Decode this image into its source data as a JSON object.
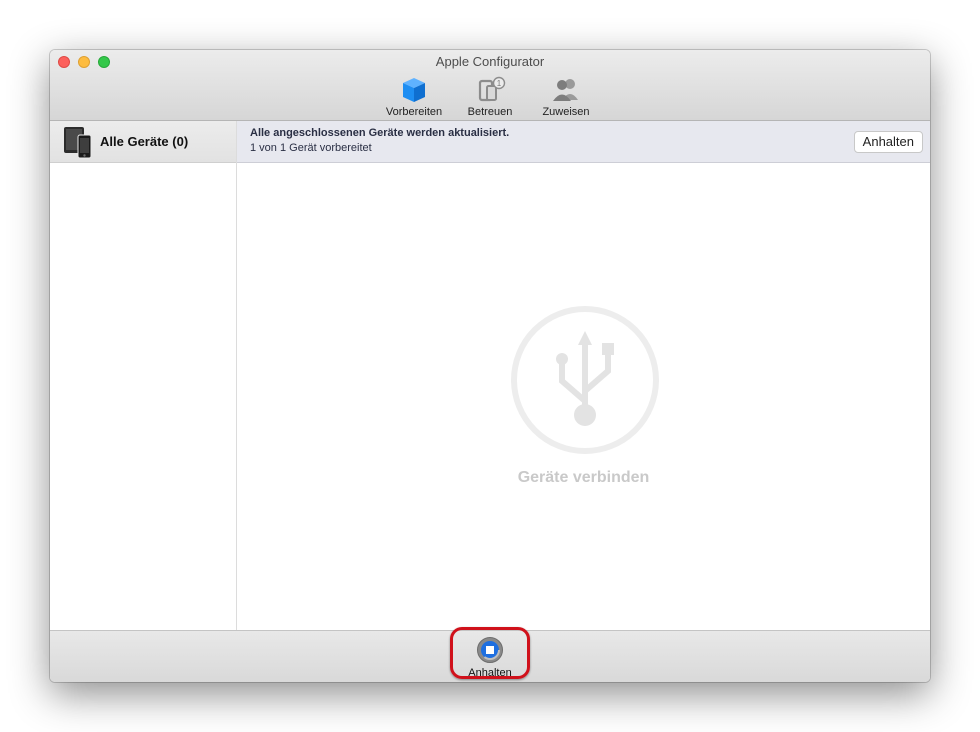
{
  "window": {
    "title": "Apple Configurator"
  },
  "toolbar": {
    "items": [
      {
        "label": "Vorbereiten",
        "icon": "cube-icon",
        "color": "#1e8ef2"
      },
      {
        "label": "Betreuen",
        "icon": "devices-badge-icon",
        "badge": "1"
      },
      {
        "label": "Zuweisen",
        "icon": "users-icon"
      }
    ]
  },
  "sidebar": {
    "header_label": "Alle Geräte (0)",
    "header_icon": "devices-icon"
  },
  "banner": {
    "title": "Alle angeschlossenen Geräte werden aktualisiert.",
    "status": "1 von 1 Gerät vorbereitet",
    "button_label": "Anhalten"
  },
  "empty_state": {
    "icon": "usb-icon",
    "text": "Geräte verbinden"
  },
  "bottom_bar": {
    "stop_label": "Anhalten",
    "stop_icon": "stop-icon",
    "highlight_color": "#d0111b"
  }
}
